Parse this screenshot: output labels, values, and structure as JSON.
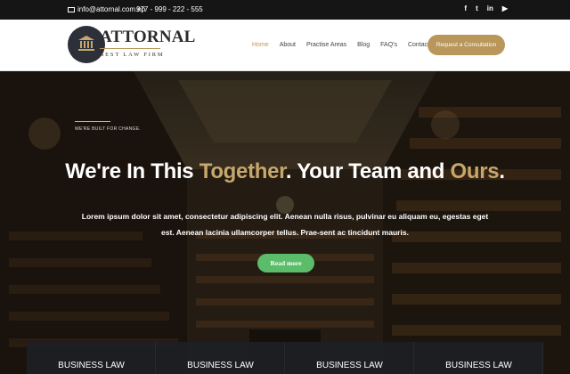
{
  "topbar": {
    "email": "info@attornal.com.np",
    "phone": "977 - 999 - 222 - 555",
    "social_icons": [
      "facebook-icon",
      "twitter-icon",
      "linkedin-icon",
      "youtube-icon"
    ],
    "social_glyphs": {
      "facebook": "f",
      "twitter": "t",
      "linkedin": "in",
      "youtube": "▶"
    }
  },
  "header": {
    "logo_name": "ATTORNAL",
    "logo_tagline": "BEST LAW FIRM",
    "nav": [
      "Home",
      "About",
      "Practise Areas",
      "Blog",
      "FAQ's",
      "Contact"
    ],
    "active_nav": "Home",
    "cta_label": "Request a Consultation"
  },
  "hero": {
    "kicker": "WE'RE BUILT FOR CHANGE.",
    "headline_parts": [
      "We're In This ",
      "Together",
      ". Your Team and ",
      "Ours",
      "."
    ],
    "lead": "Lorem ipsum dolor sit amet, consectetur adipiscing elit. Aenean nulla risus, pulvinar eu aliquam eu, egestas eget est. Aenean lacinia ullamcorper tellus. Prae-sent ac tincidunt mauris.",
    "button_label": "Read more"
  },
  "cards": [
    "BUSINESS LAW",
    "BUSINESS LAW",
    "BUSINESS LAW",
    "BUSINESS LAW"
  ],
  "colors": {
    "accent_gold": "#b9975b",
    "headline_gold": "#c7a76c",
    "button_green": "#5bbd6a",
    "topbar_bg": "#151515",
    "logo_circle": "#2d3038"
  }
}
